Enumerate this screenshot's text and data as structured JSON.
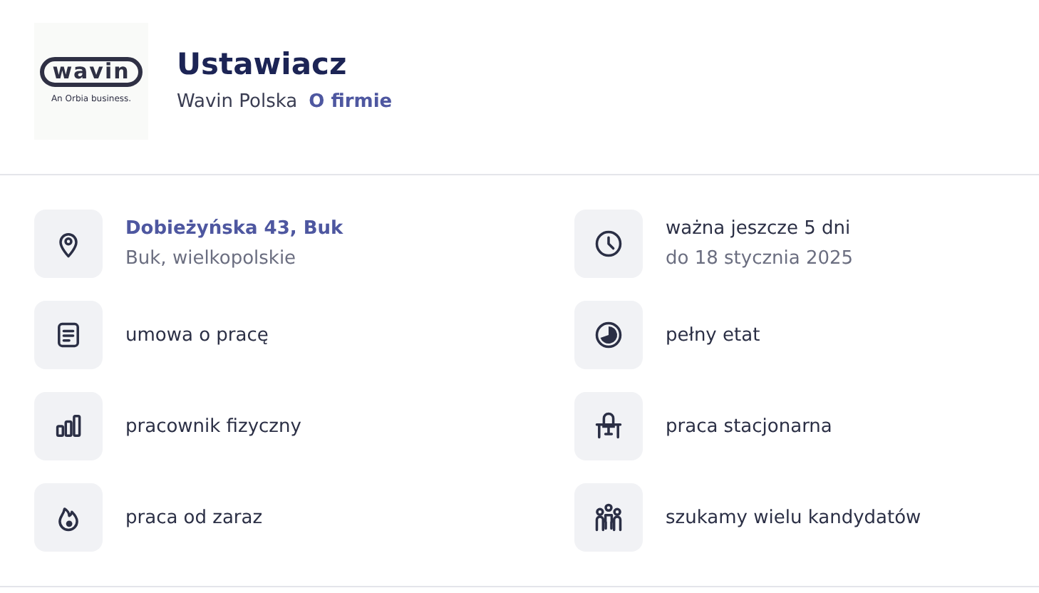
{
  "logo": {
    "wordmark": "wavin",
    "tagline": "An Orbia business."
  },
  "title": "Ustawiacz",
  "company": {
    "name": "Wavin Polska",
    "link": "O firmie"
  },
  "details": [
    {
      "kind": "address",
      "text": "Dobieżyńska 43, Buk",
      "sub": "Buk, wielkopolskie"
    },
    {
      "kind": "plain",
      "text": "ważna jeszcze 5 dni",
      "sub": "do 18 stycznia 2025"
    },
    {
      "kind": "plain",
      "text": "umowa o pracę"
    },
    {
      "kind": "plain",
      "text": "pełny etat"
    },
    {
      "kind": "plain",
      "text": "pracownik fizyczny"
    },
    {
      "kind": "plain",
      "text": "praca stacjonarna"
    },
    {
      "kind": "plain",
      "text": "praca od zaraz"
    },
    {
      "kind": "plain",
      "text": "szukamy wielu kandydatów"
    }
  ]
}
